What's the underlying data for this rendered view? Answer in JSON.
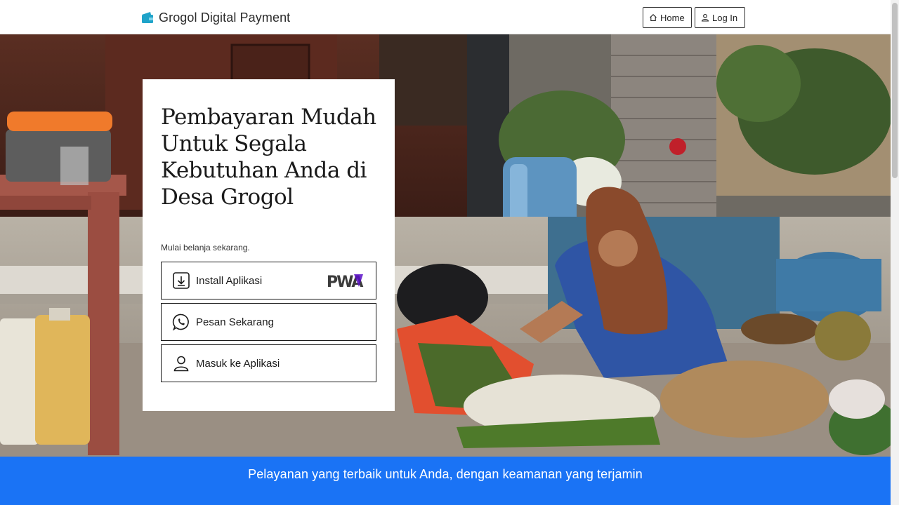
{
  "app": {
    "brand": "Grogol Digital Payment"
  },
  "nav": {
    "home_label": "Home",
    "login_label": "Log In"
  },
  "hero": {
    "title": "Pembayaran Mudah Untuk Segala Kebutuhan Anda di Desa Grogol",
    "subtitle": "Mulai belanja sekarang.",
    "actions": [
      {
        "label": "Install Aplikasi",
        "icon": "download-icon",
        "badge": "PWA"
      },
      {
        "label": "Pesan Sekarang",
        "icon": "whatsapp-icon"
      },
      {
        "label": "Masuk ke Aplikasi",
        "icon": "user-icon"
      }
    ]
  },
  "banner": {
    "text": "Pelayanan yang terbaik untuk Anda, dengan keamanan yang terjamin"
  },
  "colors": {
    "accent_blue": "#1a73f5",
    "brand_icon": "#1fa3c9",
    "pwa_purple": "#5a0fc8"
  }
}
